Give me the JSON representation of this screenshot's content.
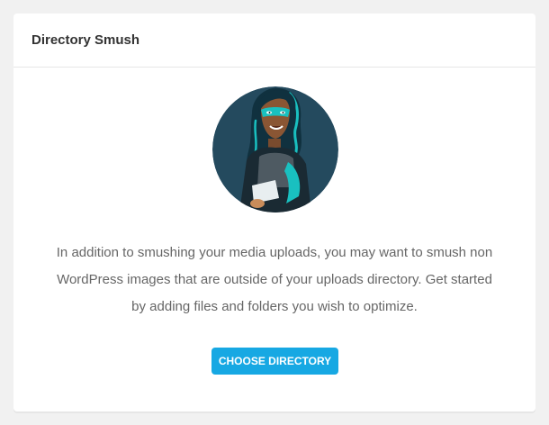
{
  "card": {
    "title": "Directory Smush",
    "description": "In addition to smushing your media uploads, you may want to smush non WordPress images that are outside of your uploads directory. Get started by adding files and folders you wish to optimize.",
    "button_label": "CHOOSE DIRECTORY"
  },
  "colors": {
    "page_background": "#f1f1f1",
    "card_background": "#ffffff",
    "button_background": "#17a8e3",
    "illustration_background": "#244a5e",
    "text": "#666666",
    "title": "#333333"
  },
  "icons": {
    "illustration": "superhero-woman-illustration"
  }
}
